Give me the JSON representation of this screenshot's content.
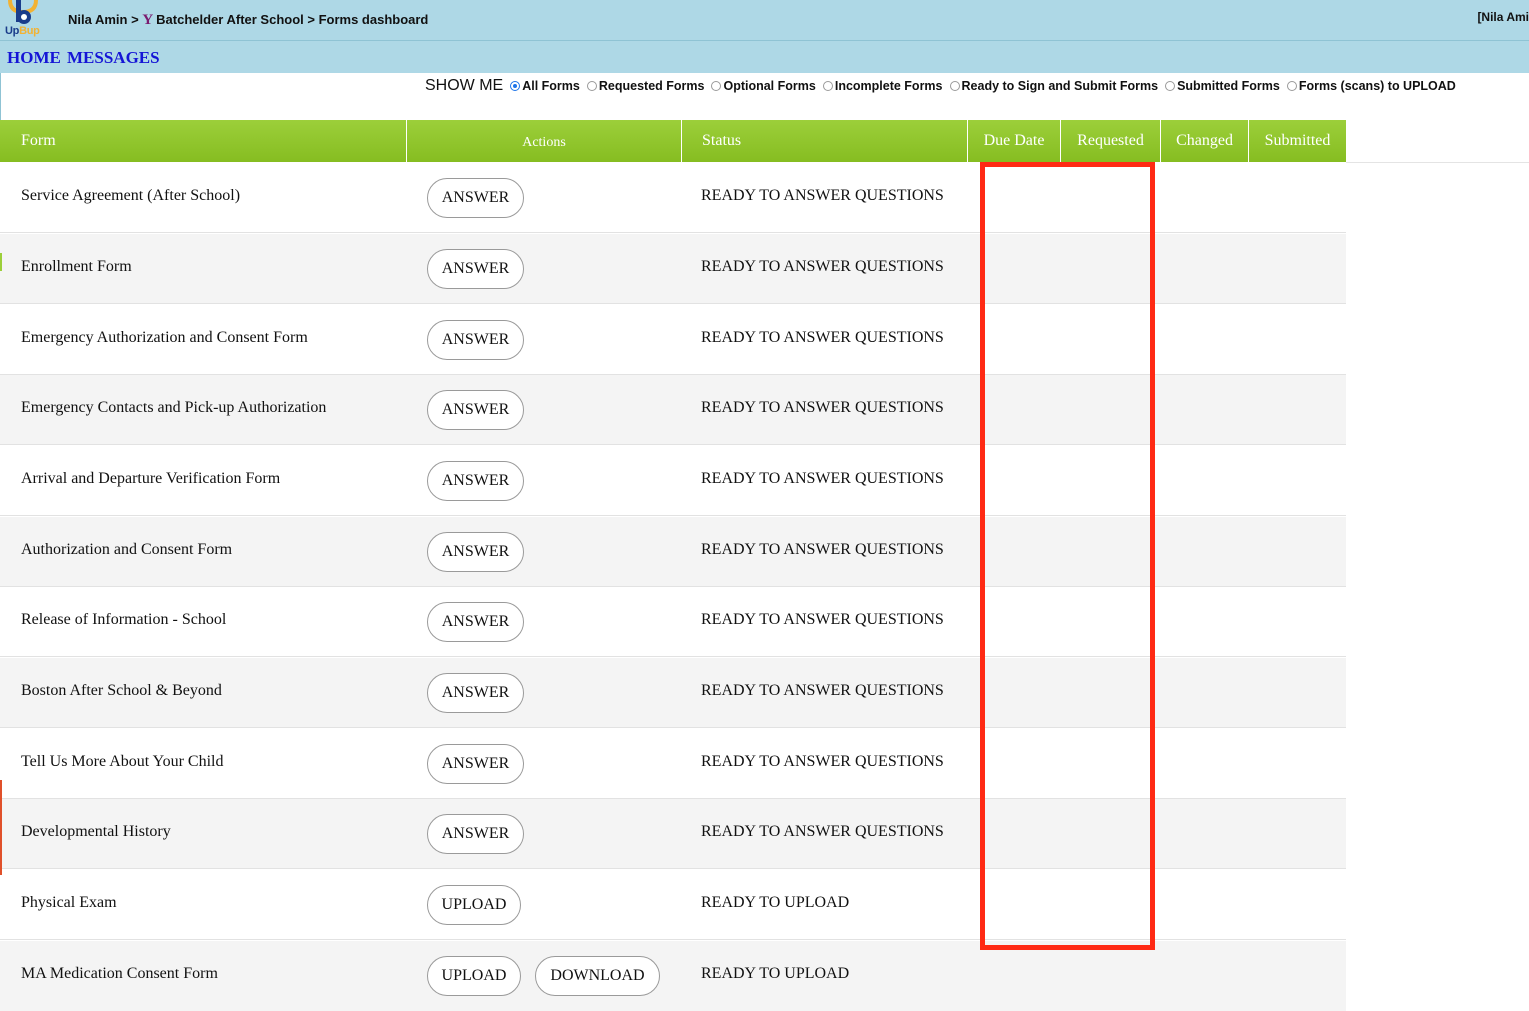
{
  "header": {
    "logo_text_up": "Up",
    "logo_text_bup": "Bup",
    "breadcrumb_user": "Nila Amin >",
    "breadcrumb_org_logo": "Y",
    "breadcrumb_org": "Batchelder After School > Forms dashboard",
    "user_tag": "[Nila Ami"
  },
  "nav": {
    "home": "HOME",
    "messages": "MESSAGES"
  },
  "filter": {
    "label": "SHOW ME",
    "options": [
      {
        "label": "All Forms",
        "checked": true
      },
      {
        "label": "Requested Forms",
        "checked": false
      },
      {
        "label": "Optional Forms",
        "checked": false
      },
      {
        "label": "Incomplete Forms",
        "checked": false
      },
      {
        "label": "Ready to Sign and Submit Forms",
        "checked": false
      },
      {
        "label": "Submitted Forms",
        "checked": false
      },
      {
        "label": "Forms (scans) to UPLOAD",
        "checked": false
      }
    ]
  },
  "table": {
    "headers": {
      "form": "Form",
      "actions": "Actions",
      "status": "Status",
      "due_date": "Due Date",
      "requested": "Requested",
      "changed": "Changed",
      "submitted": "Submitted"
    },
    "rows": [
      {
        "form": "Service Agreement (After School)",
        "actions": [
          "ANSWER"
        ],
        "status": "READY TO ANSWER QUESTIONS"
      },
      {
        "form": "Enrollment Form",
        "actions": [
          "ANSWER"
        ],
        "status": "READY TO ANSWER QUESTIONS"
      },
      {
        "form": "Emergency Authorization and Consent Form",
        "actions": [
          "ANSWER"
        ],
        "status": "READY TO ANSWER QUESTIONS"
      },
      {
        "form": "Emergency Contacts and Pick-up Authorization",
        "actions": [
          "ANSWER"
        ],
        "status": "READY TO ANSWER QUESTIONS"
      },
      {
        "form": "Arrival and Departure Verification Form",
        "actions": [
          "ANSWER"
        ],
        "status": "READY TO ANSWER QUESTIONS"
      },
      {
        "form": "Authorization and Consent Form",
        "actions": [
          "ANSWER"
        ],
        "status": "READY TO ANSWER QUESTIONS"
      },
      {
        "form": "Release of Information - School",
        "actions": [
          "ANSWER"
        ],
        "status": "READY TO ANSWER QUESTIONS"
      },
      {
        "form": "Boston After School & Beyond",
        "actions": [
          "ANSWER"
        ],
        "status": "READY TO ANSWER QUESTIONS"
      },
      {
        "form": "Tell Us More About Your Child",
        "actions": [
          "ANSWER"
        ],
        "status": "READY TO ANSWER QUESTIONS"
      },
      {
        "form": "Developmental History",
        "actions": [
          "ANSWER"
        ],
        "status": "READY TO ANSWER QUESTIONS"
      },
      {
        "form": "Physical Exam",
        "actions": [
          "UPLOAD"
        ],
        "status": "READY TO UPLOAD"
      },
      {
        "form": "MA Medication Consent Form",
        "actions": [
          "UPLOAD",
          "DOWNLOAD"
        ],
        "status": "READY TO UPLOAD"
      }
    ]
  },
  "colors": {
    "topbar": "#aed8e6",
    "header_green": "#8cc229",
    "nav_link": "#1515d6",
    "highlight": "#ff2a14"
  }
}
